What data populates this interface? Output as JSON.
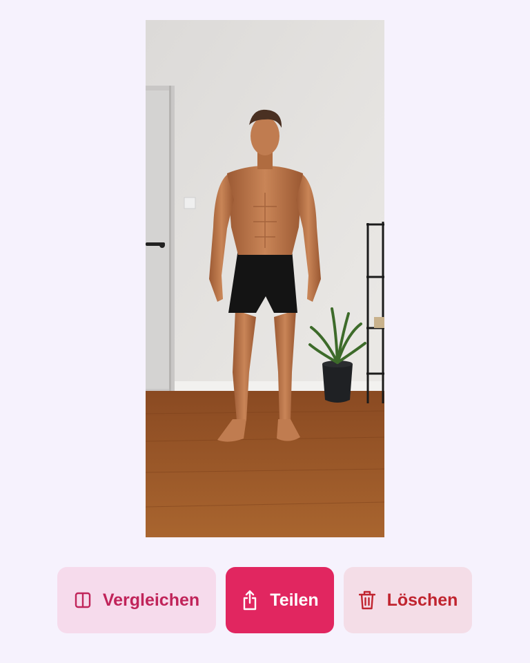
{
  "photo": {
    "subject": "progress-photo",
    "accent": "#e12660"
  },
  "actions": {
    "compare_label": "Vergleichen",
    "share_label": "Teilen",
    "delete_label": "Löschen"
  },
  "icons": {
    "compare": "split-view-icon",
    "share": "share-icon",
    "delete": "trash-icon"
  },
  "colors": {
    "background": "#f6f2fd",
    "compare_bg": "#f6dbec",
    "compare_fg": "#c0245a",
    "share_bg": "#e12660",
    "share_fg": "#ffffff",
    "delete_bg": "#f4dde7",
    "delete_fg": "#c0242f"
  }
}
